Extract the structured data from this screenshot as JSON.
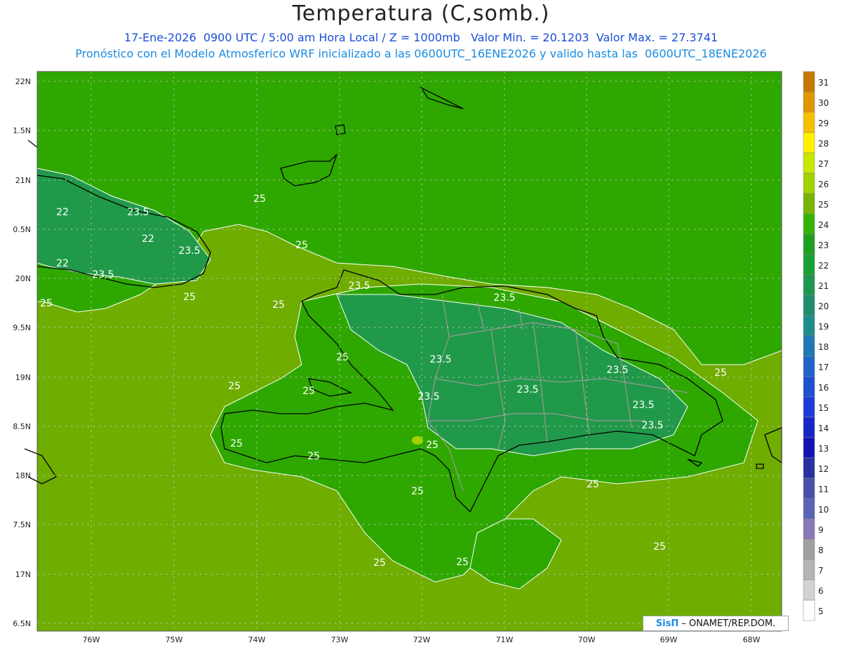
{
  "header": {
    "title": "Temperatura (C,somb.)",
    "subtitle1": "17-Ene-2026  0900 UTC / 5:00 am Hora Local / Z = 1000mb   Valor Min. = 20.1203  Valor Max. = 27.3741",
    "subtitle2": "Pronóstico con el Modelo Atmosferico WRF inicializado a las 0600UTC_16ENE2026 y valido hasta las  0600UTC_18ENE2026"
  },
  "axes": {
    "lat_labels": [
      "22N",
      "1.5N",
      "21N",
      "0.5N",
      "20N",
      "9.5N",
      "19N",
      "8.5N",
      "18N",
      "7.5N",
      "17N",
      "6.5N"
    ],
    "lon_labels": [
      "76W",
      "75W",
      "74W",
      "73W",
      "72W",
      "71W",
      "70W",
      "69W",
      "68W"
    ]
  },
  "colorbar": {
    "levels": [
      "31",
      "30",
      "29",
      "28",
      "27",
      "26",
      "25",
      "24",
      "23",
      "22",
      "21",
      "20",
      "19",
      "18",
      "17",
      "16",
      "15",
      "14",
      "13",
      "12",
      "11",
      "10",
      "9",
      "8",
      "7",
      "6",
      "5"
    ],
    "colors": [
      "#c87800",
      "#e09600",
      "#f5c000",
      "#fff000",
      "#c8e600",
      "#a0d200",
      "#78b400",
      "#32b400",
      "#1ea01e",
      "#19a032",
      "#1e9650",
      "#1e8c6e",
      "#1e8c8c",
      "#1e78b4",
      "#1e64c8",
      "#1e50d2",
      "#1e3cdc",
      "#1428c8",
      "#1414b4",
      "#2832a0",
      "#4650aa",
      "#5a64b4",
      "#8c78b4",
      "#a0a0a0",
      "#b4b4b4",
      "#d2d2d2",
      "#ffffff"
    ]
  },
  "contour_labels": [
    "25",
    "22",
    "23.5",
    "22",
    "23.5",
    "22",
    "23.5",
    "25",
    "25",
    "25",
    "25",
    "23.5",
    "23.5",
    "25",
    "23.5",
    "25",
    "25",
    "23.5",
    "23.5",
    "23.5",
    "25",
    "25",
    "23.5",
    "23.5",
    "25",
    "25",
    "25",
    "25",
    "25",
    "25",
    "25"
  ],
  "credit": {
    "sis": "SisΠ",
    "org": "– ONAMET/REP.DOM."
  }
}
